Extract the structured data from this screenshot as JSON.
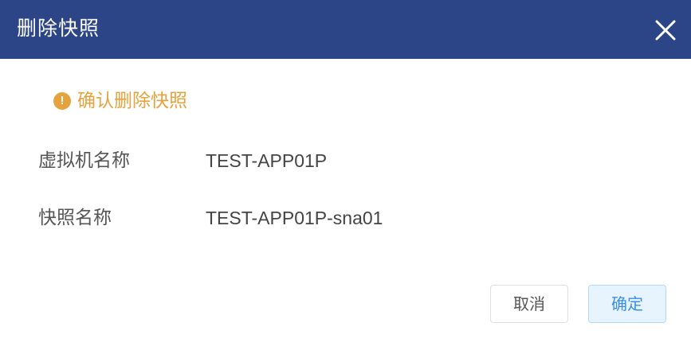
{
  "dialog": {
    "title": "删除快照",
    "close_icon": "close-icon"
  },
  "warning": {
    "icon": "exclamation-circle-icon",
    "text": "确认删除快照",
    "color": "#e6a23c"
  },
  "details": {
    "vm_name_label": "虚拟机名称",
    "vm_name_value": "TEST-APP01P",
    "snapshot_name_label": "快照名称",
    "snapshot_name_value": "TEST-APP01P-sna01"
  },
  "buttons": {
    "cancel_label": "取消",
    "confirm_label": "确定"
  },
  "colors": {
    "header": "#2c4587",
    "confirm_text": "#3a8ee6"
  }
}
